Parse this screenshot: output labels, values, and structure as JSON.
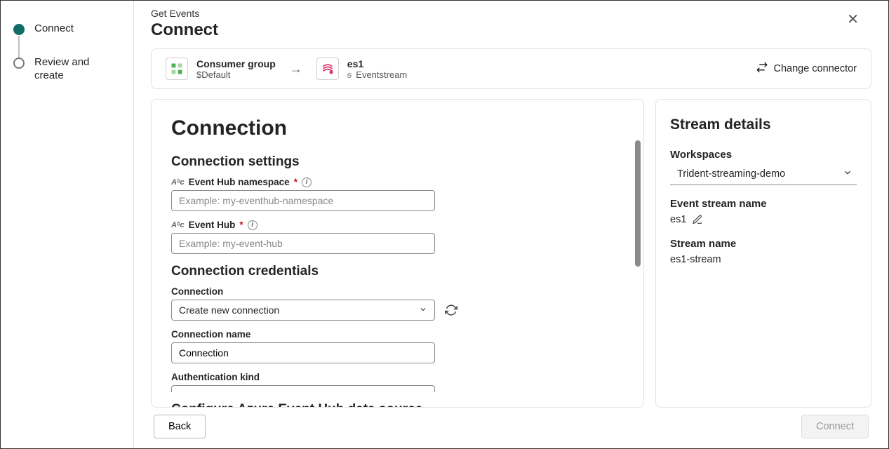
{
  "stepper": {
    "steps": [
      {
        "label": "Connect",
        "active": true
      },
      {
        "label": "Review and create",
        "active": false
      }
    ]
  },
  "header": {
    "breadcrumb": "Get Events",
    "title": "Connect"
  },
  "connector": {
    "source": {
      "title": "Consumer group",
      "subtitle": "$Default"
    },
    "target": {
      "title": "es1",
      "subtitle": "Eventstream"
    },
    "change_label": "Change connector"
  },
  "form": {
    "heading": "Connection",
    "section_settings": "Connection settings",
    "namespace_label": "Event Hub namespace",
    "namespace_placeholder": "Example: my-eventhub-namespace",
    "namespace_value": "",
    "hub_label": "Event Hub",
    "hub_placeholder": "Example: my-event-hub",
    "hub_value": "",
    "section_creds": "Connection credentials",
    "connection_label": "Connection",
    "connection_selected": "Create new connection",
    "connection_name_label": "Connection name",
    "connection_name_value": "Connection",
    "auth_label": "Authentication kind",
    "section_configure": "Configure Azure Event Hub data source"
  },
  "details": {
    "heading": "Stream details",
    "workspaces_label": "Workspaces",
    "workspaces_value": "Trident-streaming-demo",
    "eventstream_label": "Event stream name",
    "eventstream_value": "es1",
    "streamname_label": "Stream name",
    "streamname_value": "es1-stream"
  },
  "footer": {
    "back": "Back",
    "connect": "Connect"
  }
}
